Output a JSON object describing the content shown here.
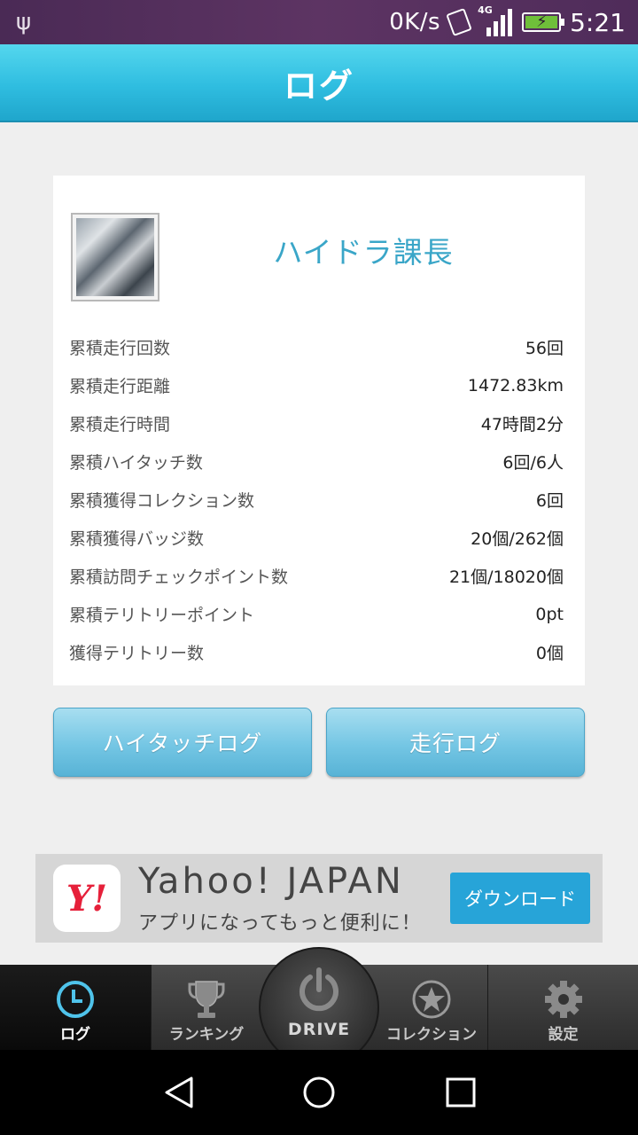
{
  "status_bar": {
    "network_speed": "0K/s",
    "network_type": "4G",
    "time": "5:21",
    "icons": [
      "usb-icon",
      "vibrate-icon",
      "signal-icon",
      "battery-charging-icon"
    ]
  },
  "header": {
    "title": "ログ"
  },
  "profile": {
    "name": "ハイドラ課長",
    "stats": [
      {
        "label": "累積走行回数",
        "value": "56回"
      },
      {
        "label": "累積走行距離",
        "value": "1472.83km"
      },
      {
        "label": "累積走行時間",
        "value": "47時間2分"
      },
      {
        "label": "累積ハイタッチ数",
        "value": "6回/6人"
      },
      {
        "label": "累積獲得コレクション数",
        "value": "6回"
      },
      {
        "label": "累積獲得バッジ数",
        "value": "20個/262個"
      },
      {
        "label": "累積訪問チェックポイント数",
        "value": "21個/18020個"
      },
      {
        "label": "累積テリトリーポイント",
        "value": "0pt"
      },
      {
        "label": "獲得テリトリー数",
        "value": "0個"
      }
    ]
  },
  "buttons": {
    "hightouch_log": "ハイタッチログ",
    "drive_log": "走行ログ"
  },
  "ad": {
    "logo_text": "Y!",
    "title": "Yahoo! JAPAN",
    "subtitle": "アプリになってもっと便利に！",
    "cta": "ダウンロード"
  },
  "tabs": {
    "log": "ログ",
    "ranking": "ランキング",
    "drive": "DRIVE",
    "collection": "コレクション",
    "settings": "設定"
  },
  "colors": {
    "accent": "#2fbde0",
    "username": "#3aa6c8",
    "active_tab_icon": "#4fc3ea",
    "ad_button": "#27a4d8"
  }
}
